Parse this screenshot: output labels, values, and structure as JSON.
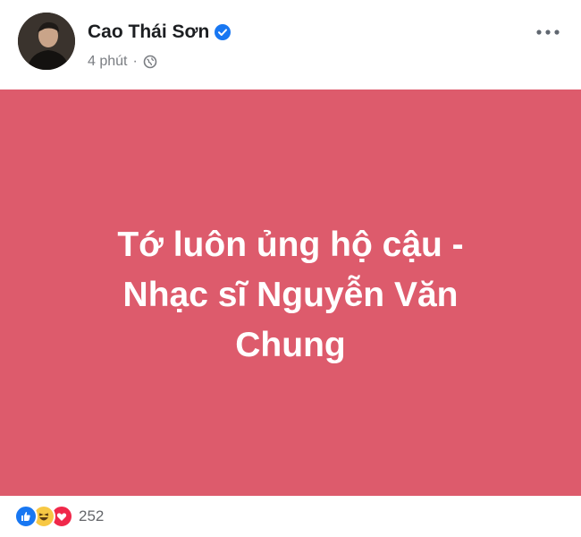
{
  "post": {
    "author": {
      "name": "Cao Thái Sơn",
      "verified": true,
      "avatar_icon": "user-avatar"
    },
    "timestamp": "4 phút",
    "separator": "·",
    "privacy_icon": "globe-icon",
    "more_icon": "more-horizontal-icon",
    "background_color": "#dd5b6c",
    "text_color": "#ffffff",
    "text": "Tớ luôn ủng hộ cậu - Nhạc sĩ Nguyễn Văn Chung"
  },
  "reactions": {
    "icons": [
      "like-icon",
      "haha-icon",
      "love-icon"
    ],
    "count": "252"
  }
}
